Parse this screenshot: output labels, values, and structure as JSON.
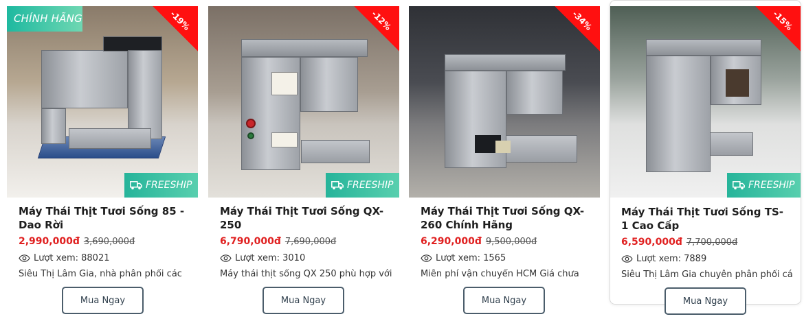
{
  "products": [
    {
      "genuine_badge": "CHÍNH HÃNG",
      "discount": "-19%",
      "freeship": "FREESHIP",
      "title": "Máy Thái Thịt Tươi Sống 85 - Dao Rời",
      "price": "2,990,000đ",
      "old_price": "3,690,000đ",
      "views": "Lượt xem: 88021",
      "description": "Siêu Thị Lâm Gia, nhà phân phối các",
      "button": "Mua Ngay"
    },
    {
      "discount": "-12%",
      "freeship": "FREESHIP",
      "title": "Máy Thái Thịt Tươi Sống QX-250",
      "price": "6,790,000đ",
      "old_price": "7,690,000đ",
      "views": "Lượt xem: 3010",
      "description": "Máy thái thịt sống QX 250 phù hợp với",
      "button": "Mua Ngay"
    },
    {
      "discount": "-34%",
      "title": "Máy Thái Thịt Tươi Sống QX-260 Chính Hãng",
      "price": "6,290,000đ",
      "old_price": "9,500,000đ",
      "views": "Lượt xem: 1565",
      "description": "Miễn phí vận chuyển HCM Giá chưa",
      "button": "Mua Ngay"
    },
    {
      "discount": "-15%",
      "freeship": "FREESHIP",
      "title": "Máy Thái Thịt Tươi Sống TS-1 Cao Cấp",
      "price": "6,590,000đ",
      "old_price": "7,700,000đ",
      "views": "Lượt xem: 7889",
      "description": "Siêu Thị Lâm Gia chuyên phân phối các",
      "button": "Mua Ngay"
    }
  ],
  "colors": {
    "discount_bg": "#ff1010",
    "badge_teal": "#26b49a",
    "price_red": "#e02020",
    "button_border": "#4b5d6b"
  },
  "icons": {
    "freeship": "truck-icon",
    "views": "eye-icon"
  }
}
